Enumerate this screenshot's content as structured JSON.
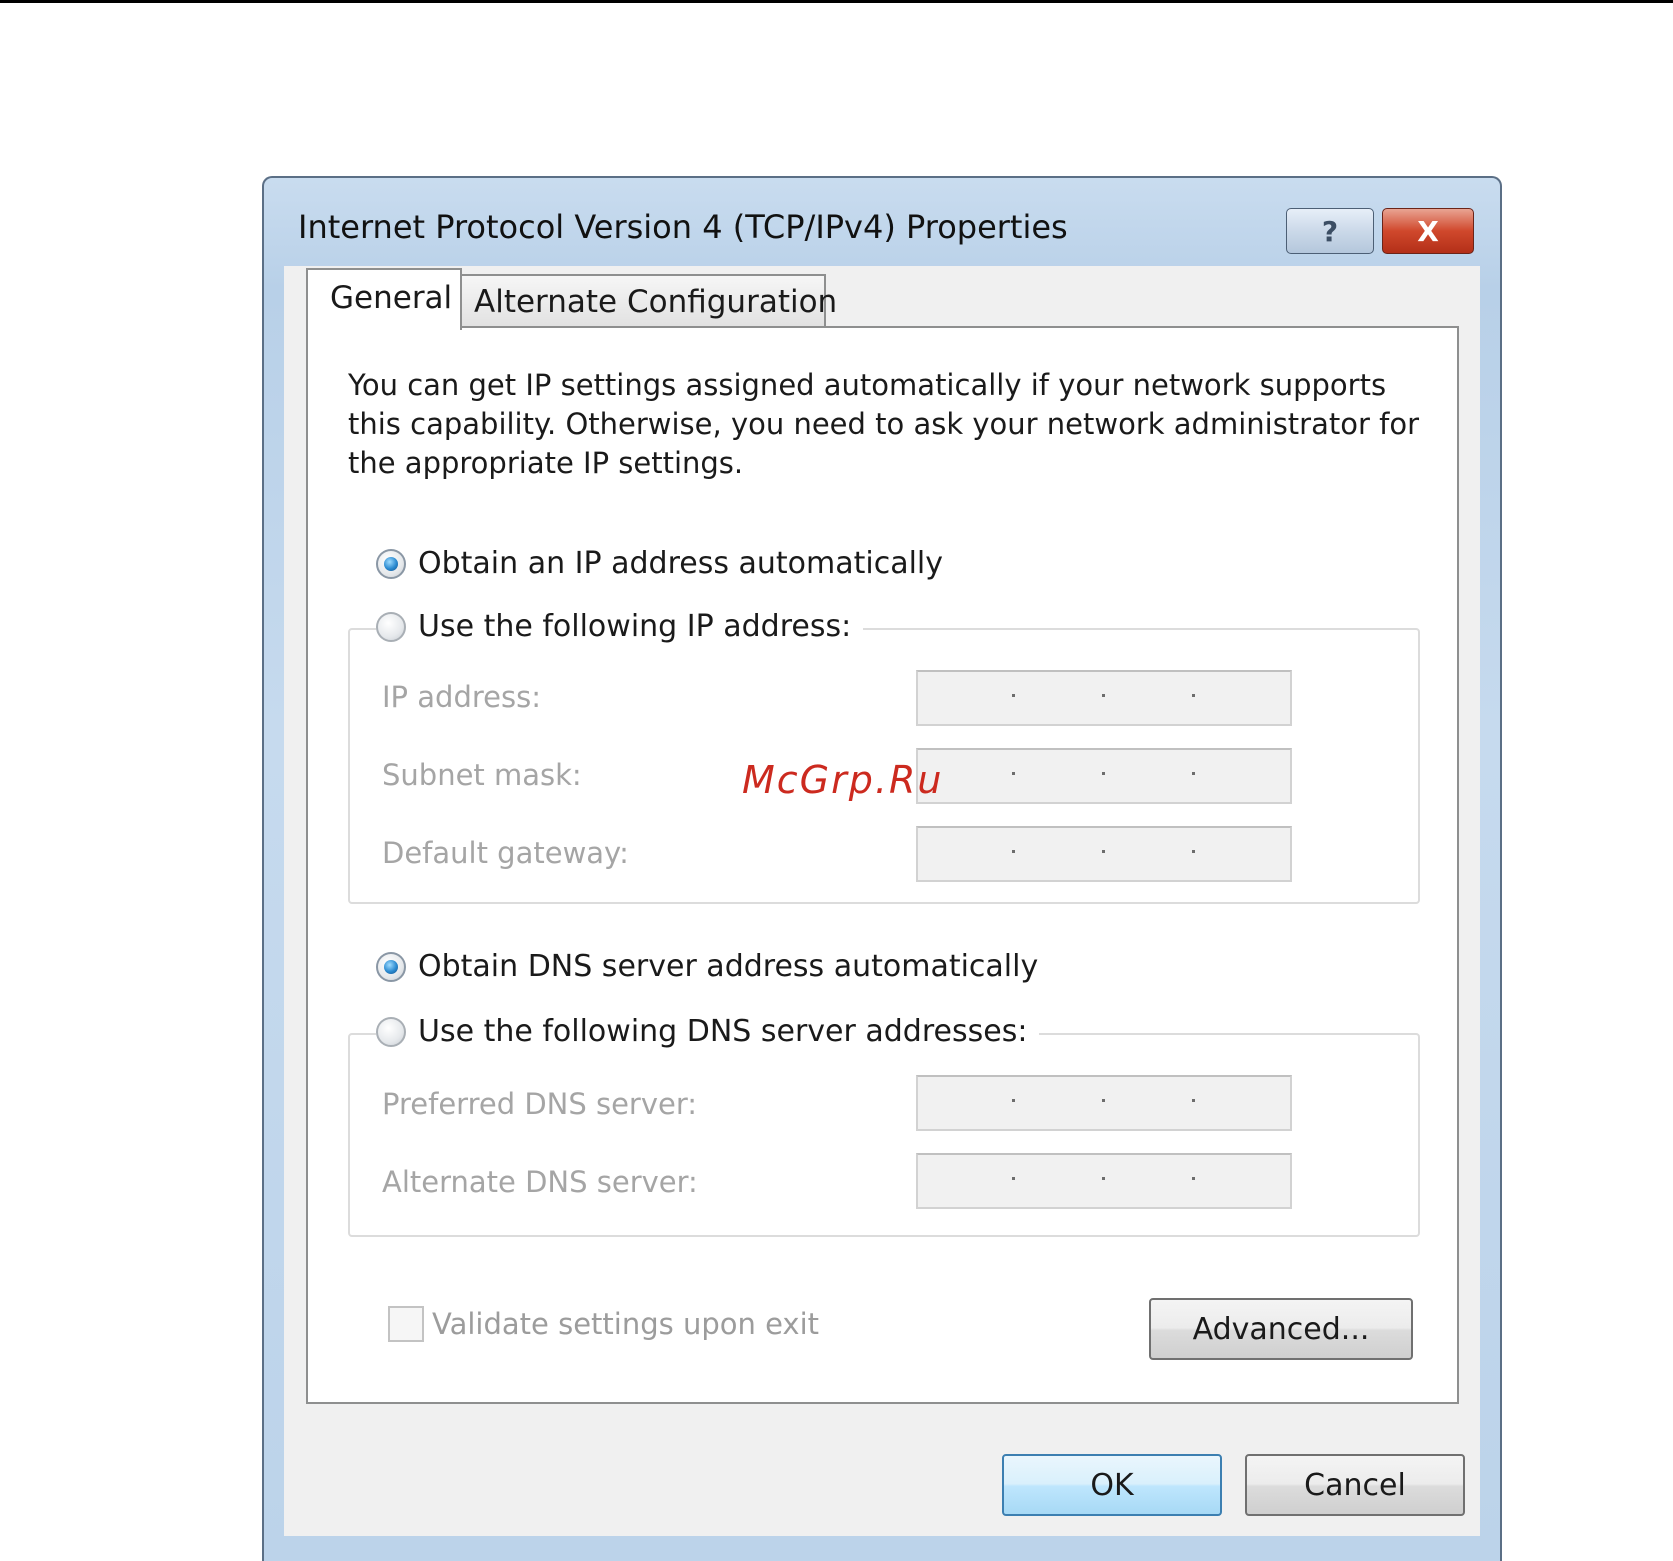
{
  "window": {
    "title": "Internet Protocol Version 4 (TCP/IPv4) Properties",
    "help_label": "?",
    "close_label": "X"
  },
  "tabs": [
    {
      "label": "General",
      "selected": true
    },
    {
      "label": "Alternate Configuration",
      "selected": false
    }
  ],
  "general": {
    "intro": "You can get IP settings assigned automatically if your network supports this capability. Otherwise, you need to ask your network administrator for the appropriate IP settings.",
    "ip": {
      "auto_label": "Obtain an IP address automatically",
      "manual_label": "Use the following IP address:",
      "selected": "auto",
      "fields": [
        {
          "label": "IP address:",
          "value": ""
        },
        {
          "label": "Subnet mask:",
          "value": ""
        },
        {
          "label": "Default gateway:",
          "value": ""
        }
      ]
    },
    "dns": {
      "auto_label": "Obtain DNS server address automatically",
      "manual_label": "Use the following DNS server addresses:",
      "selected": "auto",
      "fields": [
        {
          "label": "Preferred DNS server:",
          "value": ""
        },
        {
          "label": "Alternate DNS server:",
          "value": ""
        }
      ]
    },
    "validate_label": "Validate settings upon exit",
    "validate_checked": false,
    "advanced_label": "Advanced..."
  },
  "buttons": {
    "ok": "OK",
    "cancel": "Cancel"
  },
  "watermark": "McGrp.Ru",
  "colors": {
    "frame": "#bcd3ea",
    "close_button": "#d0482c",
    "ok_button": "#bee6fd",
    "disabled_text": "#a5a5a5",
    "watermark": "#cc2a1f"
  }
}
